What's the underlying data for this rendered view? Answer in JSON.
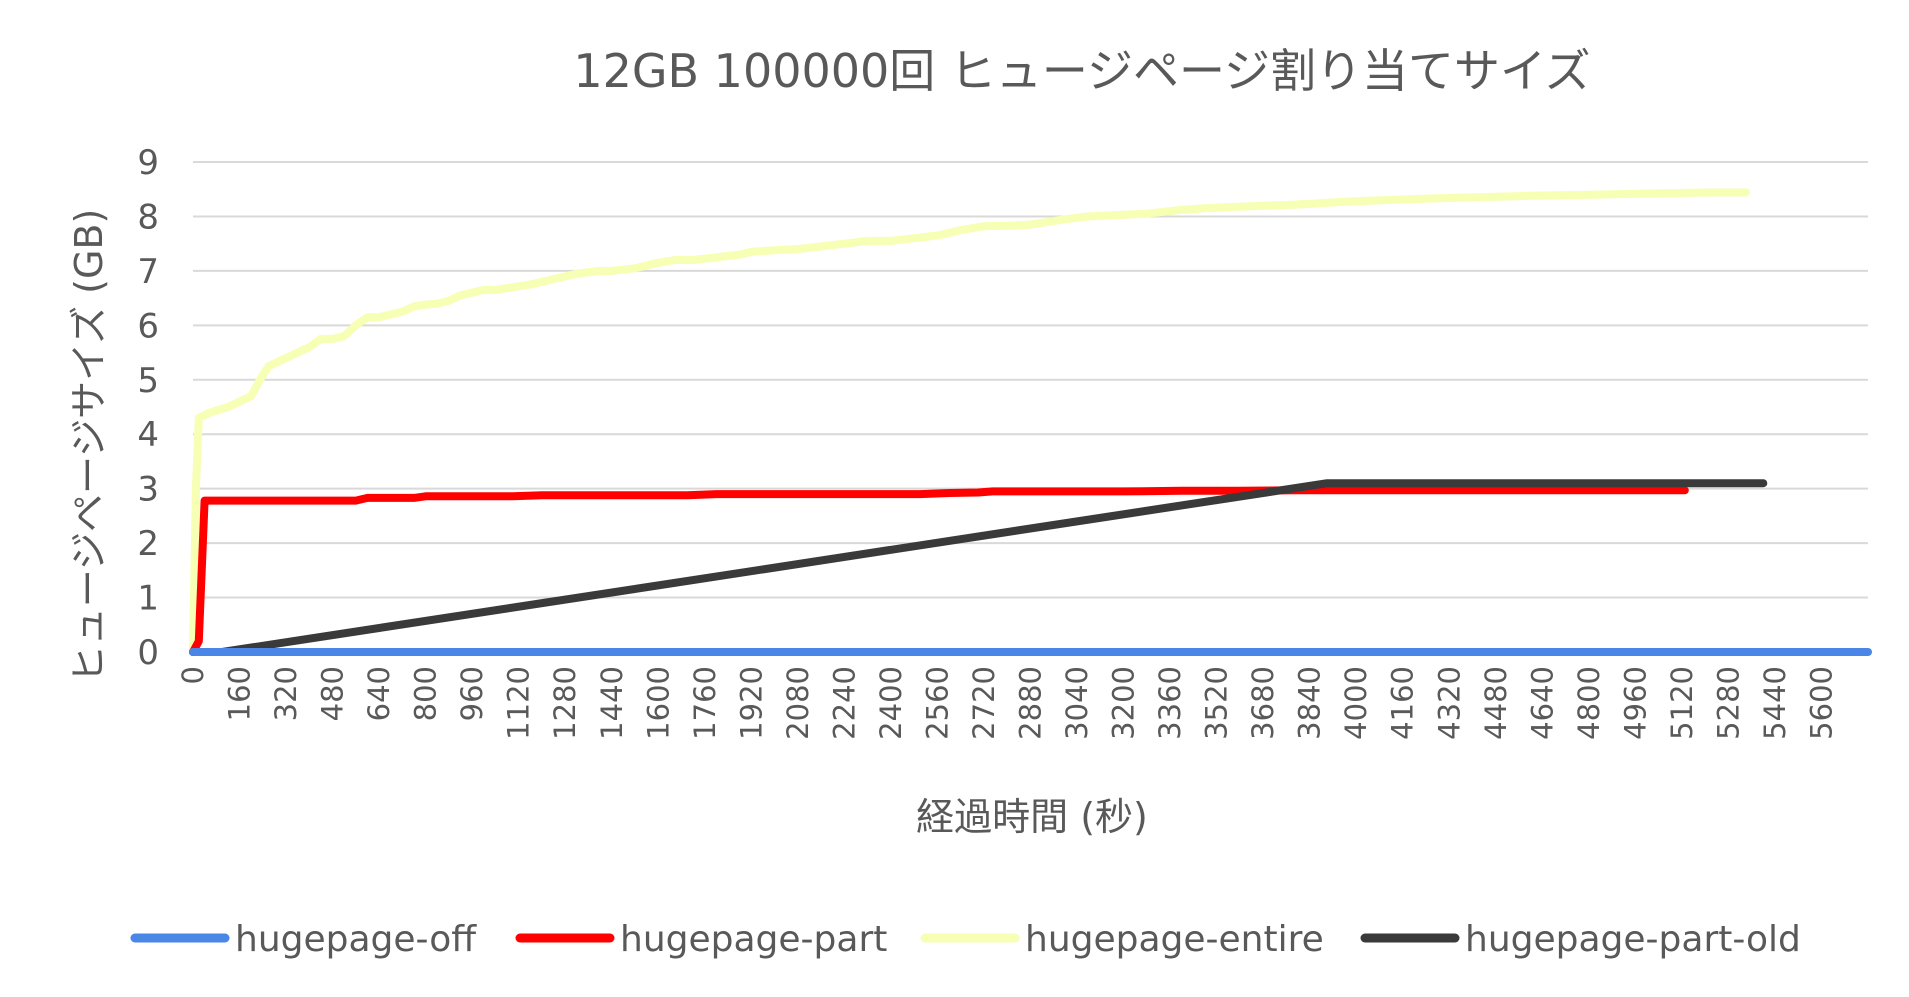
{
  "chart_data": {
    "type": "line",
    "title": "12GB 100000回 ヒュージページ割り当てサイズ",
    "xlabel": "経過時間 (秒)",
    "ylabel": "ヒュージページサイズ (GB)",
    "xlim": [
      0,
      5760
    ],
    "ylim": [
      0,
      9
    ],
    "x_ticks": [
      "0",
      "160",
      "320",
      "480",
      "640",
      "800",
      "960",
      "1120",
      "1280",
      "1440",
      "1600",
      "1760",
      "1920",
      "2080",
      "2240",
      "2400",
      "2560",
      "2720",
      "2880",
      "3040",
      "3200",
      "3360",
      "3520",
      "3680",
      "3840",
      "4000",
      "4160",
      "4320",
      "4480",
      "4640",
      "4800",
      "4960",
      "5120",
      "5280",
      "5440",
      "5600"
    ],
    "y_ticks": [
      "0",
      "1",
      "2",
      "3",
      "4",
      "5",
      "6",
      "7",
      "8",
      "9"
    ],
    "grid": true,
    "legend_position": "bottom",
    "series": [
      {
        "name": "hugepage-off",
        "color": "#4a86e8",
        "x": [
          0,
          5760
        ],
        "y": [
          0,
          0
        ]
      },
      {
        "name": "hugepage-part",
        "color": "#ff0000",
        "x": [
          0,
          20,
          40,
          560,
          600,
          760,
          800,
          1100,
          1200,
          1700,
          1800,
          2500,
          2600,
          2700,
          2750,
          3200,
          3400,
          3600,
          3800,
          4100,
          4500,
          5000,
          5130
        ],
        "y": [
          0,
          0.2,
          2.78,
          2.78,
          2.83,
          2.83,
          2.86,
          2.86,
          2.88,
          2.88,
          2.9,
          2.9,
          2.92,
          2.93,
          2.95,
          2.95,
          2.96,
          2.96,
          2.97,
          2.97,
          2.97,
          2.97,
          2.97
        ]
      },
      {
        "name": "hugepage-entire",
        "color": "#f6ffb3",
        "x": [
          0,
          10,
          20,
          60,
          120,
          160,
          200,
          230,
          260,
          300,
          340,
          380,
          400,
          440,
          480,
          520,
          560,
          600,
          640,
          680,
          720,
          760,
          800,
          840,
          880,
          920,
          960,
          1000,
          1040,
          1100,
          1160,
          1240,
          1320,
          1400,
          1440,
          1520,
          1600,
          1660,
          1720,
          1800,
          1880,
          1920,
          2000,
          2080,
          2160,
          2240,
          2320,
          2400,
          2480,
          2560,
          2640,
          2720,
          2800,
          2880,
          3000,
          3080,
          3200,
          3280,
          3400,
          3480,
          3600,
          3700,
          3800,
          3900,
          4000,
          4100,
          4200,
          4400,
          4600,
          4800,
          5000,
          5200,
          5340
        ],
        "y": [
          0,
          3.0,
          4.3,
          4.4,
          4.5,
          4.6,
          4.7,
          5.0,
          5.25,
          5.35,
          5.45,
          5.55,
          5.6,
          5.75,
          5.75,
          5.8,
          6.0,
          6.15,
          6.15,
          6.2,
          6.25,
          6.35,
          6.38,
          6.4,
          6.45,
          6.55,
          6.6,
          6.65,
          6.65,
          6.7,
          6.75,
          6.85,
          6.95,
          7.0,
          7.0,
          7.05,
          7.15,
          7.2,
          7.2,
          7.25,
          7.3,
          7.35,
          7.38,
          7.4,
          7.45,
          7.5,
          7.55,
          7.55,
          7.6,
          7.65,
          7.75,
          7.82,
          7.83,
          7.85,
          7.95,
          8.0,
          8.03,
          8.05,
          8.12,
          8.15,
          8.18,
          8.2,
          8.22,
          8.25,
          8.28,
          8.3,
          8.32,
          8.35,
          8.38,
          8.4,
          8.42,
          8.44,
          8.44
        ]
      },
      {
        "name": "hugepage-part-old",
        "color": "#3a3a3a",
        "x": [
          0,
          100,
          3900,
          5400
        ],
        "y": [
          0,
          0,
          3.1,
          3.1
        ]
      }
    ]
  }
}
